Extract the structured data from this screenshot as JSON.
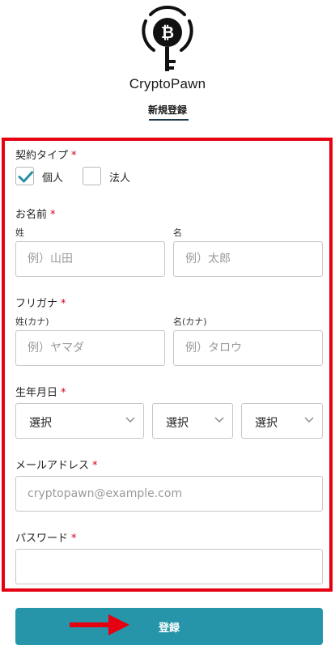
{
  "header": {
    "brand": "CryptoPawn",
    "tab_label": "新規登録"
  },
  "form": {
    "contract_type": {
      "label": "契約タイプ",
      "required_mark": "*",
      "options": [
        {
          "label": "個人",
          "checked": true
        },
        {
          "label": "法人",
          "checked": false
        }
      ]
    },
    "name": {
      "label": "お名前",
      "required_mark": "*",
      "last": {
        "label": "姓",
        "placeholder": "例）山田"
      },
      "first": {
        "label": "名",
        "placeholder": "例）太郎"
      }
    },
    "furigana": {
      "label": "フリガナ",
      "required_mark": "*",
      "last": {
        "label": "姓(カナ)",
        "placeholder": "例）ヤマダ"
      },
      "first": {
        "label": "名(カナ)",
        "placeholder": "例）タロウ"
      }
    },
    "birthdate": {
      "label": "生年月日",
      "required_mark": "*",
      "year": "選択",
      "month": "選択",
      "day": "選択"
    },
    "email": {
      "label": "メールアドレス",
      "required_mark": "*",
      "placeholder": "cryptopawn@example.com"
    },
    "password": {
      "label": "パスワード",
      "required_mark": "*",
      "placeholder": ""
    }
  },
  "submit": {
    "label": "登録"
  },
  "colors": {
    "accent": "#2695a9",
    "highlight_frame": "#e50012",
    "required": "#d0021b",
    "check": "#2a8fa3"
  },
  "icons": {
    "logo": "bitcoin-key-logo",
    "check": "checkmark-icon",
    "chevron": "chevron-down-icon",
    "arrow": "red-arrow-right-icon"
  }
}
